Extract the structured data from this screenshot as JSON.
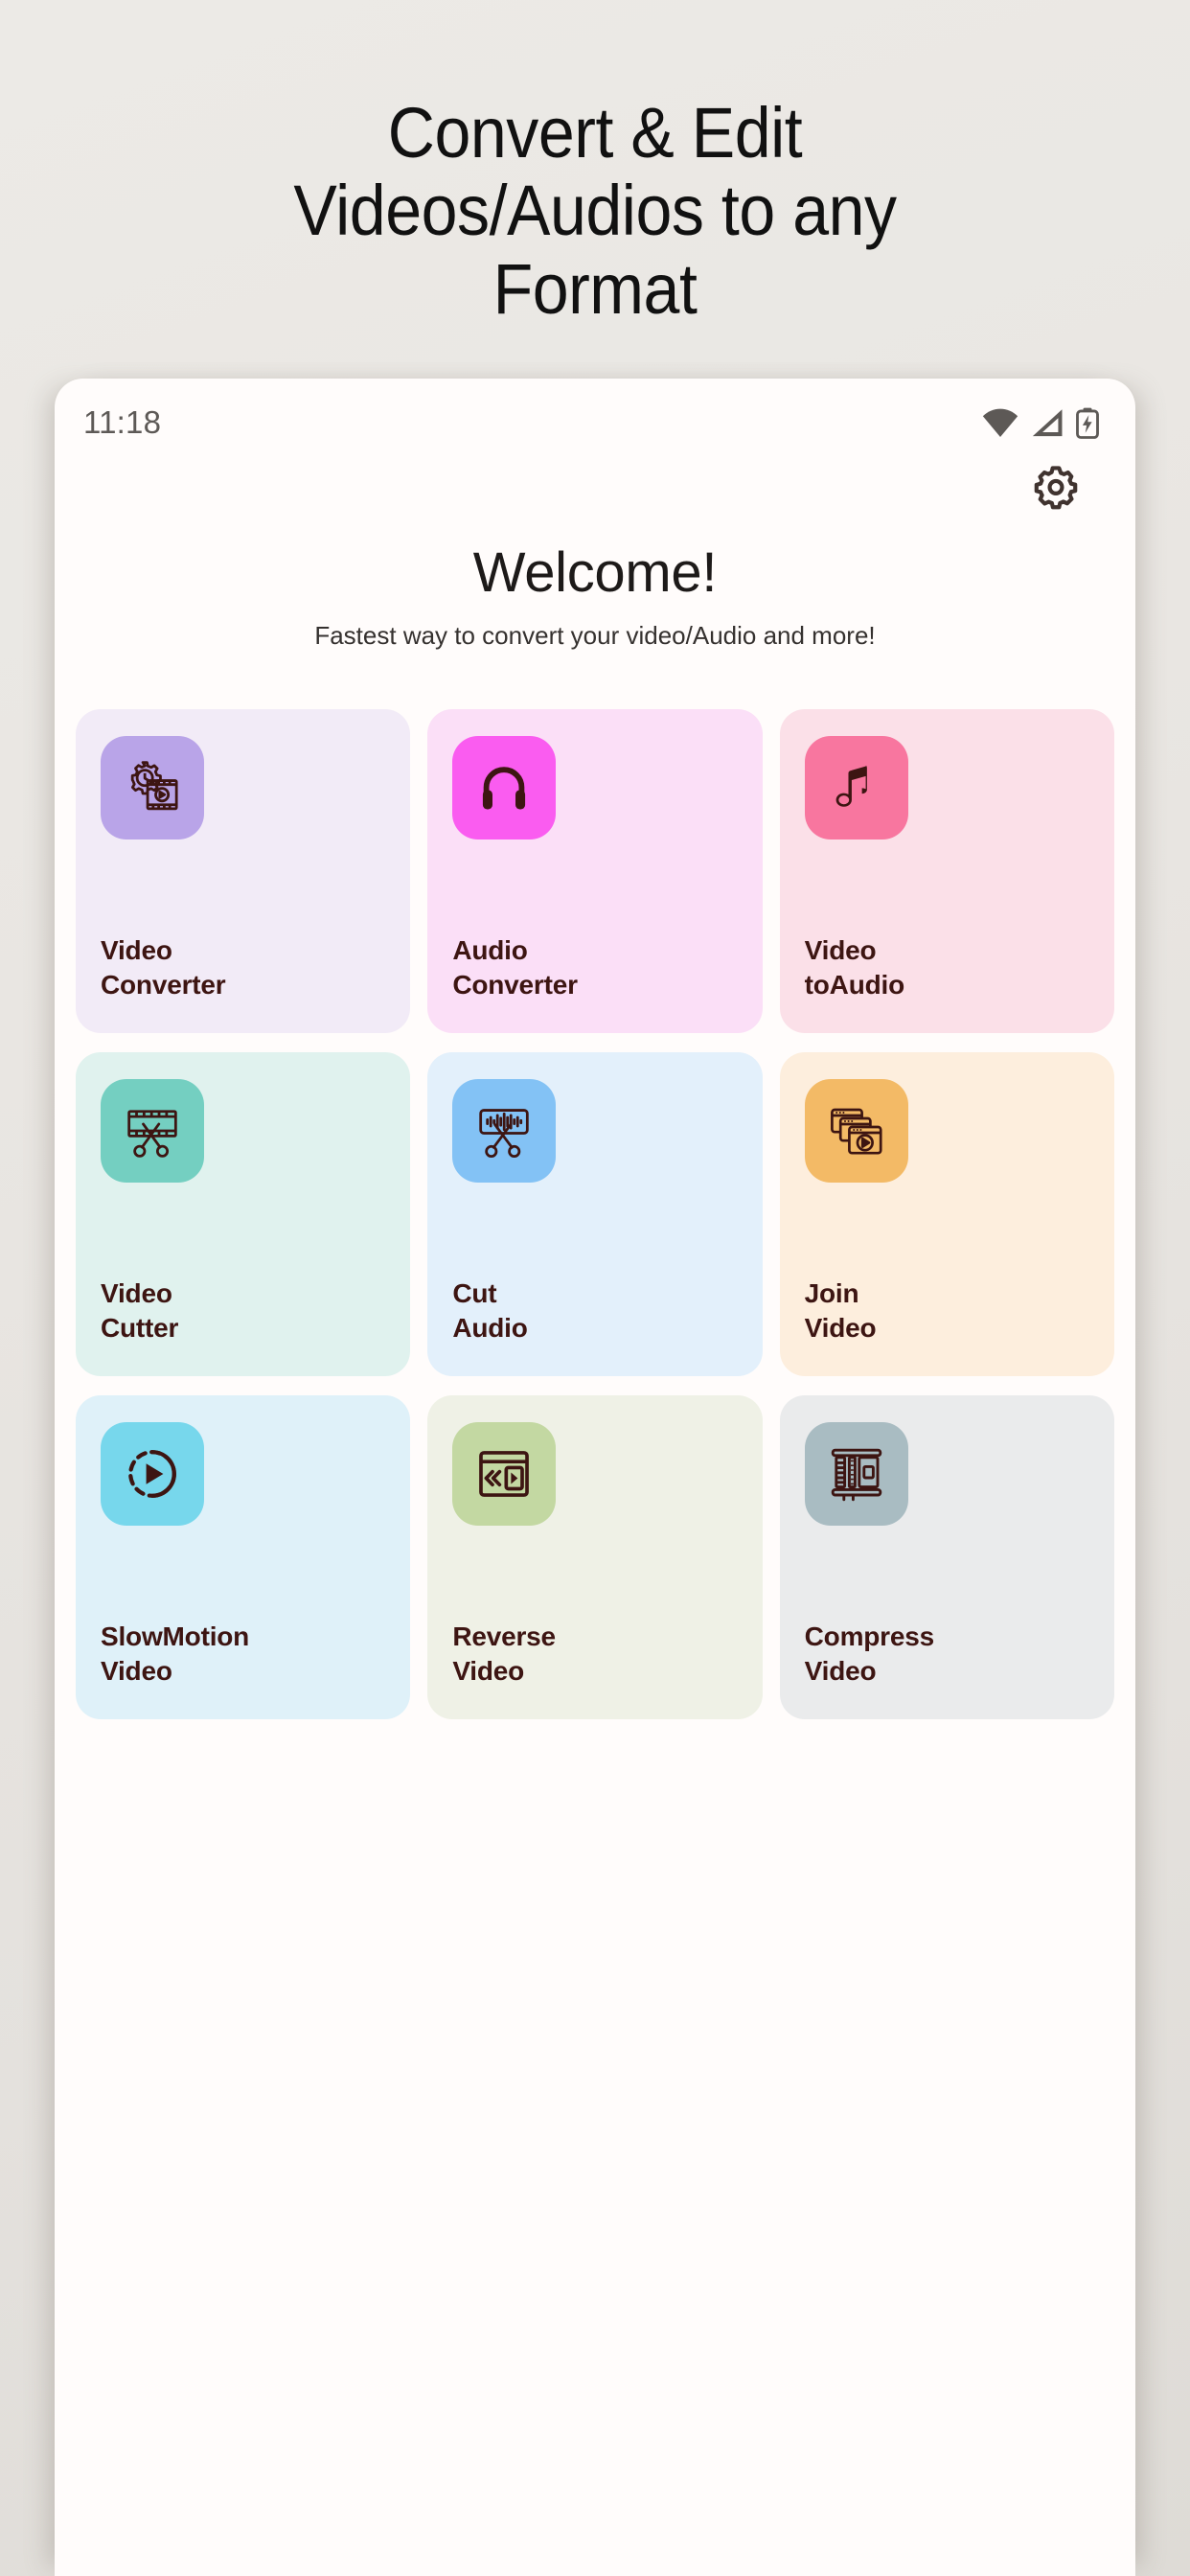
{
  "promo": {
    "headline_lines": [
      "Convert & Edit",
      "Videos/Audios to any",
      "Format"
    ]
  },
  "phone": {
    "status_bar": {
      "time": "11:18",
      "icons": [
        "wifi-icon",
        "cellular-signal-icon",
        "battery-charging-icon"
      ]
    },
    "header": {
      "settings_icon": "gear-icon"
    },
    "welcome": {
      "title": "Welcome!",
      "subtitle": "Fastest way to convert your video/Audio and more!"
    },
    "tiles": [
      {
        "id": "video-converter",
        "label": "Video\nConverter",
        "icon": "video-gear-icon",
        "tile_bg": "#f2ebf7",
        "icon_bg": "#b9a4e8",
        "text_color": "#3d1512"
      },
      {
        "id": "audio-converter",
        "label": "Audio\nConverter",
        "icon": "headphones-icon",
        "tile_bg": "#fbdff7",
        "icon_bg": "#fa5cf0",
        "text_color": "#3d1512"
      },
      {
        "id": "video-to-audio",
        "label": "Video\ntoAudio",
        "icon": "music-note-icon",
        "tile_bg": "#fbe0e8",
        "icon_bg": "#f8769f",
        "text_color": "#3d1512"
      },
      {
        "id": "video-cutter",
        "label": "Video\nCutter",
        "icon": "film-scissors-icon",
        "tile_bg": "#e0f2ee",
        "icon_bg": "#74cfc1",
        "text_color": "#3d1512"
      },
      {
        "id": "cut-audio",
        "label": "Cut\nAudio",
        "icon": "waveform-scissors-icon",
        "tile_bg": "#e3f0fb",
        "icon_bg": "#83c2f5",
        "text_color": "#3d1512"
      },
      {
        "id": "join-video",
        "label": "Join\nVideo",
        "icon": "stacked-windows-play-icon",
        "tile_bg": "#fdeedd",
        "icon_bg": "#f3b濃66",
        "text_color": "#3d1512"
      },
      {
        "id": "slowmotion-video",
        "label": "SlowMotion\nVideo",
        "icon": "slow-motion-play-icon",
        "tile_bg": "#dff1f9",
        "icon_bg": "#77d7ec",
        "text_color": "#3d1512"
      },
      {
        "id": "reverse-video",
        "label": "Reverse\nVideo",
        "icon": "reverse-play-window-icon",
        "tile_bg": "#eff1e6",
        "icon_bg": "#c3d8a2",
        "text_color": "#3d1512"
      },
      {
        "id": "compress-video",
        "label": "Compress\nVideo",
        "icon": "compress-film-icon",
        "tile_bg": "#eaebec",
        "icon_bg": "#a9bcc2",
        "text_color": "#3d1512"
      }
    ]
  },
  "colors": {
    "page_bg": "#e9e6e2",
    "phone_bg": "#fffcfb",
    "headline_text": "#111111",
    "status_icon": "#5d5956",
    "tile_text": "#3d1512"
  }
}
